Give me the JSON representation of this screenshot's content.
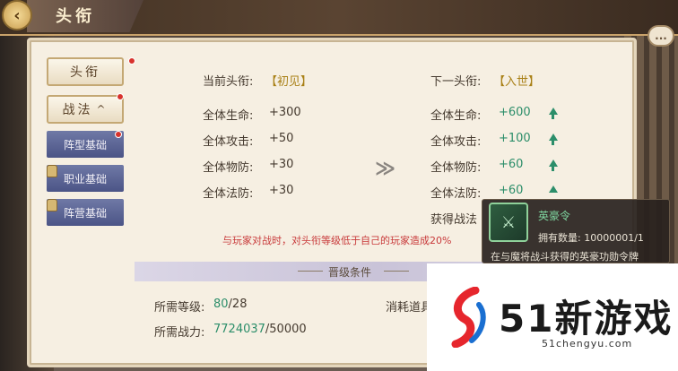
{
  "header": {
    "title": "头衔",
    "back_icon": "back-arrow-icon",
    "chat_icon": "chat-bubble-icon",
    "chat_label": "..."
  },
  "sidebar": {
    "tabs": [
      {
        "label": "头衔",
        "badge": true
      },
      {
        "label": "战法",
        "badge": true,
        "chevron": "^"
      }
    ],
    "subtabs": [
      {
        "label": "阵型基础",
        "badge": true,
        "locked": false
      },
      {
        "label": "职业基础",
        "badge": false,
        "locked": true
      },
      {
        "label": "阵营基础",
        "badge": false,
        "locked": true
      }
    ]
  },
  "current": {
    "label": "当前头衔:",
    "rank": "【初见】",
    "stats": [
      {
        "name": "全体生命:",
        "value": "+300"
      },
      {
        "name": "全体攻击:",
        "value": "+50"
      },
      {
        "name": "全体物防:",
        "value": "+30"
      },
      {
        "name": "全体法防:",
        "value": "+30"
      }
    ]
  },
  "next": {
    "label": "下一头衔:",
    "rank": "【入世】",
    "stats": [
      {
        "name": "全体生命:",
        "value": "+600"
      },
      {
        "name": "全体攻击:",
        "value": "+100"
      },
      {
        "name": "全体物防:",
        "value": "+60"
      },
      {
        "name": "全体法防:",
        "value": "+60"
      }
    ],
    "extra_label": "获得战法"
  },
  "warning": "与玩家对战时，对头衔等级低于自己的玩家造成20%",
  "upgrade": {
    "section_title": "晋级条件",
    "level_label": "所需等级:",
    "level_current": "80",
    "level_required": "/28",
    "power_label": "所需战力:",
    "power_current": "7724037",
    "power_required": "/50000",
    "consume_label": "消耗道具"
  },
  "tooltip": {
    "name": "英豪令",
    "count_label": "拥有数量: 10000001/1",
    "desc": "在与魔将战斗获得的英豪功勋令牌",
    "icon": "token-icon"
  },
  "watermark": {
    "text": "51新游戏",
    "url": "51chengyu.com"
  },
  "colors": {
    "accent_gold": "#a98016",
    "stat_up_green": "#2c8e6a",
    "warning_red": "#c8393a",
    "subtab_blue": "#4b5486"
  }
}
